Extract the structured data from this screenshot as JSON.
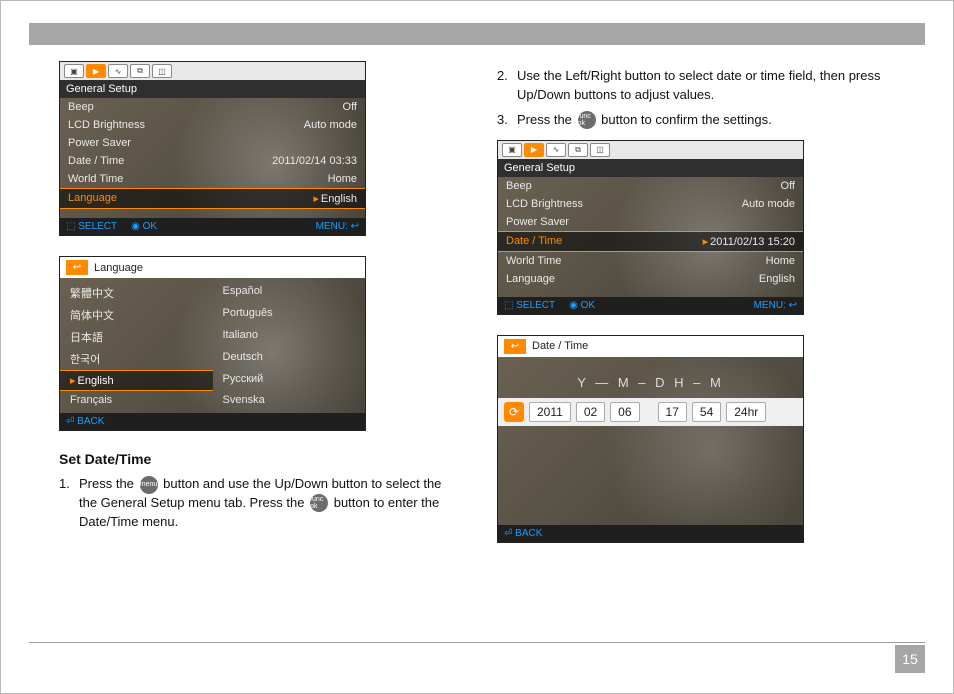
{
  "page_number": "15",
  "section_heading": "Set Date/Time",
  "steps": {
    "s1_a": "Press the",
    "s1_b": "button and use the Up/Down button to select the the General Setup menu tab. Press the",
    "s1_c": "button to enter the Date/Time menu.",
    "s2": "Use the Left/Right button to select date or time field, then press Up/Down buttons to adjust values.",
    "s3_a": "Press the",
    "s3_b": "button to confirm the settings."
  },
  "buttons": {
    "menu": "menu",
    "func": "func ok"
  },
  "lcd1": {
    "title": "General Setup",
    "rows": [
      {
        "k": "Beep",
        "v": "Off"
      },
      {
        "k": "LCD Brightness",
        "v": "Auto mode"
      },
      {
        "k": "Power Saver",
        "v": ""
      },
      {
        "k": "Date / Time",
        "v": "2011/02/14 03:33"
      },
      {
        "k": "World Time",
        "v": "Home"
      },
      {
        "k": "Language",
        "v": "English",
        "hot": true,
        "arrow": true
      }
    ],
    "foot": {
      "select": "SELECT",
      "ok": "OK",
      "menu": "MENU:"
    }
  },
  "lcd2": {
    "title": "Language",
    "left": [
      "繁體中文",
      "简体中文",
      "日本語",
      "한국어",
      "English",
      "Français"
    ],
    "right": [
      "Español",
      "Português",
      "Italiano",
      "Deutsch",
      "Русский",
      "Svenska"
    ],
    "selected_index": 4,
    "foot": {
      "back": "BACK"
    }
  },
  "lcd3": {
    "title": "General Setup",
    "rows": [
      {
        "k": "Beep",
        "v": "Off"
      },
      {
        "k": "LCD Brightness",
        "v": "Auto mode"
      },
      {
        "k": "Power Saver",
        "v": ""
      },
      {
        "k": "Date / Time",
        "v": "2011/02/13 15:20",
        "hot": true,
        "arrow": true
      },
      {
        "k": "World Time",
        "v": "Home"
      },
      {
        "k": "Language",
        "v": "English"
      }
    ],
    "foot": {
      "select": "SELECT",
      "ok": "OK",
      "menu": "MENU:"
    }
  },
  "lcd4": {
    "title": "Date / Time",
    "label": "Y — M – D   H – M",
    "fields": [
      "2011",
      "02",
      "06",
      "17",
      "54",
      "24hr"
    ],
    "foot": {
      "back": "BACK"
    }
  }
}
